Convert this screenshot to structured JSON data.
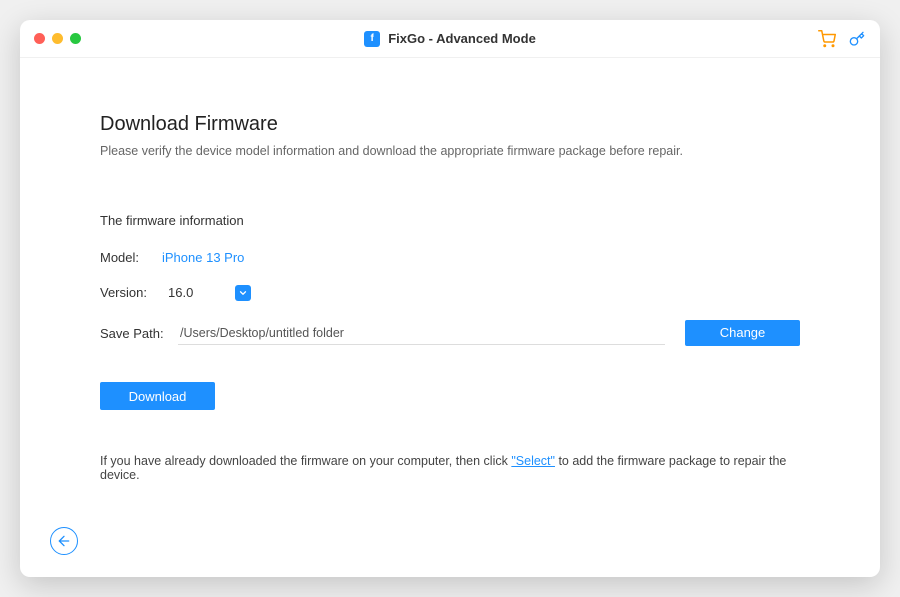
{
  "titlebar": {
    "app_name": "FixGo - Advanced Mode",
    "logo_letter": "f"
  },
  "page": {
    "heading": "Download Firmware",
    "subtitle": "Please verify the device model information and download the appropriate firmware package before repair.",
    "section_title": "The firmware information"
  },
  "model": {
    "label": "Model:",
    "value": "iPhone 13 Pro"
  },
  "version": {
    "label": "Version:",
    "value": "16.0"
  },
  "savepath": {
    "label": "Save Path:",
    "value": "/Users/Desktop/untitled folder",
    "change_label": "Change"
  },
  "download": {
    "label": "Download"
  },
  "footnote": {
    "prefix": "If you have already downloaded the firmware on your computer, then click ",
    "link": "\"Select\"",
    "suffix": " to add the firmware package to repair the device."
  }
}
